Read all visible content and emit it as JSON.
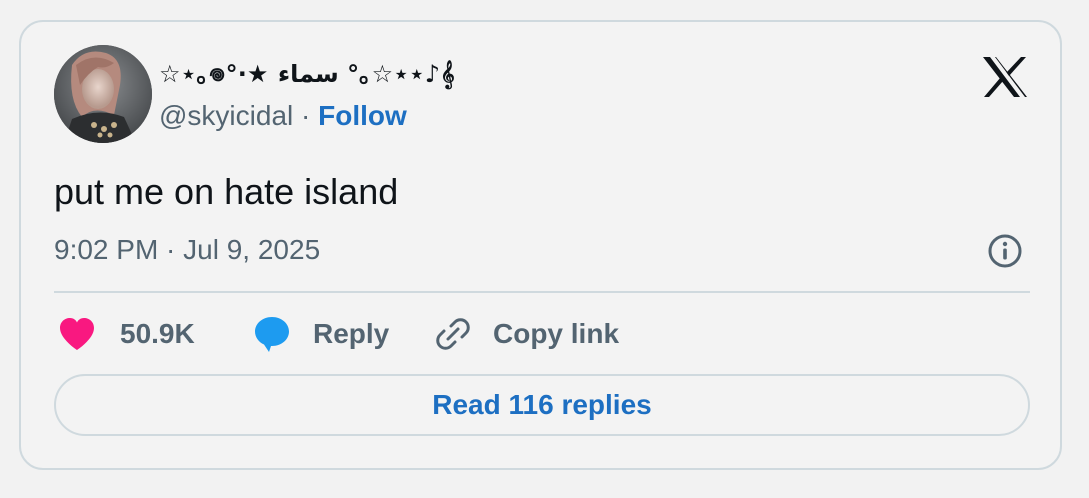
{
  "tweet": {
    "display_name": "☆⋆｡𖦹°‧★ سماء °｡☆⋆⋆♪𝄞⁠",
    "handle": "@skyicidal",
    "separator": "·",
    "follow_label": "Follow",
    "text": "put me on hate island",
    "timestamp": "9:02 PM · Jul 9, 2025"
  },
  "actions": {
    "like_count": "50.9K",
    "reply_label": "Reply",
    "copy_link_label": "Copy link",
    "read_replies_label": "Read 116 replies"
  },
  "icons": {
    "brand": "x-logo-icon",
    "info": "info-icon",
    "like": "heart-icon",
    "reply": "speech-bubble-icon",
    "copy": "link-icon"
  },
  "colors": {
    "heart": "#f91880",
    "reply_bubble": "#1d9bf0",
    "follow": "#1d6fc2",
    "muted": "#536471",
    "border": "#cfd9de"
  }
}
